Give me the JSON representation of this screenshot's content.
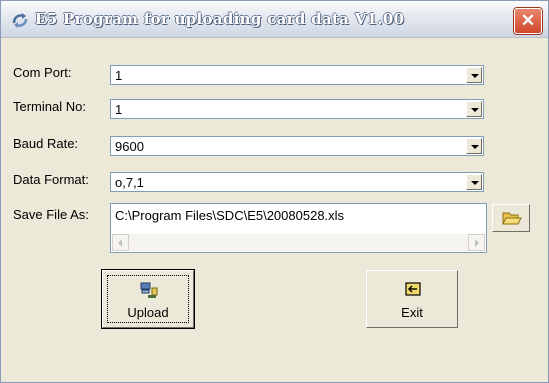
{
  "window": {
    "title": "E5 Program for uploading card data V1.00",
    "close_glyph": "✕"
  },
  "fields": {
    "com_port": {
      "label": "Com Port:",
      "value": "1"
    },
    "terminal_no": {
      "label": "Terminal No:",
      "value": "1"
    },
    "baud_rate": {
      "label": "Baud Rate:",
      "value": "9600"
    },
    "data_format": {
      "label": "Data Format:",
      "value": "o,7,1"
    },
    "save_file": {
      "label": "Save File As:",
      "value": "C:\\Program Files\\SDC\\E5\\20080528.xls"
    }
  },
  "buttons": {
    "upload": "Upload",
    "exit": "Exit"
  },
  "icons": {
    "app": "app-icon",
    "browse": "folder-open-icon",
    "upload": "upload-icon",
    "exit": "exit-icon",
    "dropdown": "chevron-down-icon"
  },
  "colors": {
    "close_button": "#d0482b",
    "field_border": "#7f9db9",
    "dialog_face": "#ece9d8"
  }
}
